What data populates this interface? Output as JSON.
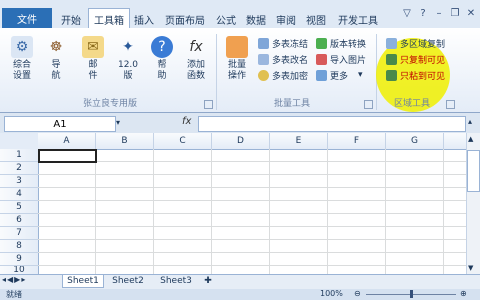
{
  "ribbon_tabs": [
    "文件",
    "开始",
    "工具箱",
    "插入",
    "页面布局",
    "公式",
    "数据",
    "审阅",
    "视图",
    "开发工具"
  ],
  "active_tab": "工具箱",
  "groups": [
    {
      "label": "张立良专用版"
    },
    {
      "label": "批量工具"
    },
    {
      "label": "区域工具"
    }
  ],
  "big_buttons": [
    {
      "label": "综合\n设置",
      "icon": "settings-gears-icon"
    },
    {
      "label": "导\n航",
      "icon": "ship-wheel-icon"
    },
    {
      "label": "邮\n件",
      "icon": "mail-envelope-icon"
    },
    {
      "label": "12.0\n版",
      "icon": "magic-wand-icon"
    },
    {
      "label": "帮\n助",
      "icon": "help-question-icon"
    },
    {
      "label": "添加\n函数",
      "icon": "function-fx-icon"
    },
    {
      "label": "批量\n操作",
      "icon": "batch-grid-icon"
    }
  ],
  "batch_small": [
    "多表冻结",
    "多表改名",
    "多表加密"
  ],
  "batch_small2": [
    "版本转换",
    "导入图片",
    "更多"
  ],
  "region_small": [
    "多区域复制",
    "只复制可见",
    "只粘到可见"
  ],
  "name_box": "A1",
  "fx": "fx",
  "columns": [
    "A",
    "B",
    "C",
    "D",
    "E",
    "F",
    "G"
  ],
  "rows": [
    "1",
    "2",
    "3",
    "4",
    "5",
    "6",
    "7",
    "8",
    "9",
    "10"
  ],
  "sheets": [
    "Sheet1",
    "Sheet2",
    "Sheet3"
  ],
  "status_text": "就绪",
  "zoom": "100%",
  "colors": {
    "file_tab": "#2b6fb6",
    "highlight": "#f0f000"
  }
}
